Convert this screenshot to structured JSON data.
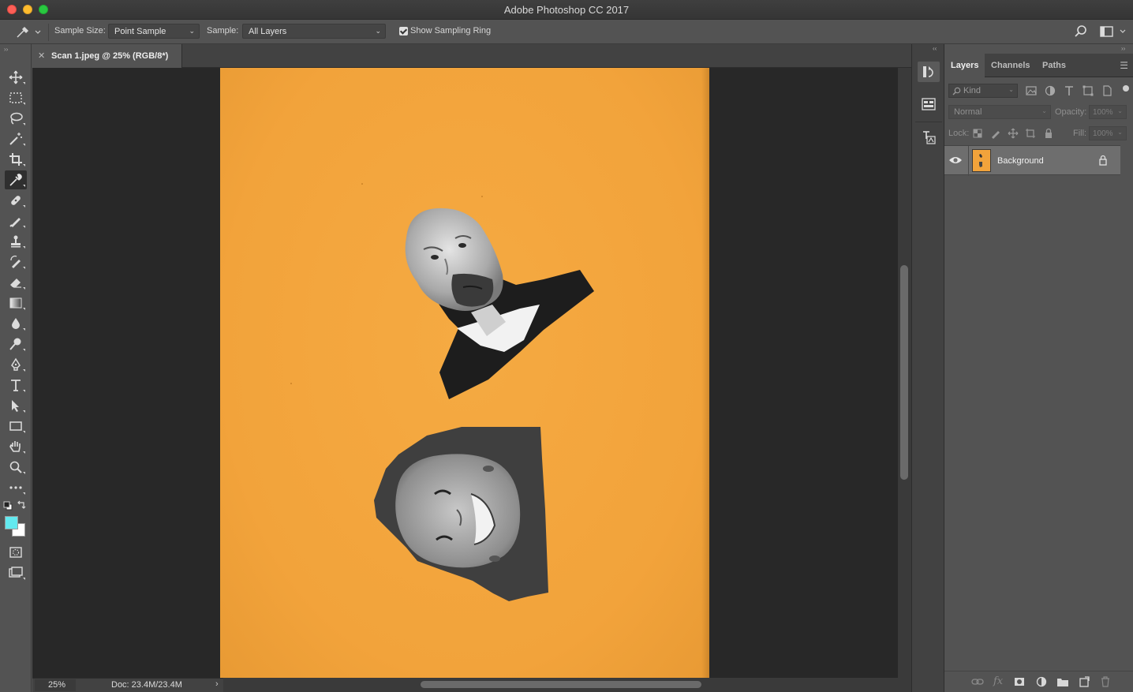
{
  "window": {
    "title": "Adobe Photoshop CC 2017"
  },
  "options_bar": {
    "sample_size_label": "Sample Size:",
    "sample_size_value": "Point Sample",
    "sample_label": "Sample:",
    "sample_value": "All Layers",
    "show_ring_label": "Show Sampling Ring",
    "show_ring_checked": true
  },
  "document": {
    "tab_title": "Scan 1.jpeg @ 25% (RGB/8*)",
    "zoom": "25%",
    "doc_info": "Doc: 23.4M/23.4M",
    "canvas_color": "#f2a33b"
  },
  "toolbar": {
    "foreground_color": "#63e9ef",
    "background_color": "#ffffff",
    "active_tool": "eyedropper-tool"
  },
  "layers_panel": {
    "tabs": [
      "Layers",
      "Channels",
      "Paths"
    ],
    "active_tab": "Layers",
    "filter_placeholder": "Kind",
    "blend_mode": "Normal",
    "opacity_label": "Opacity:",
    "opacity_value": "100%",
    "lock_label": "Lock:",
    "fill_label": "Fill:",
    "fill_value": "100%",
    "layers": [
      {
        "name": "Background",
        "visible": true,
        "locked": true
      }
    ]
  }
}
